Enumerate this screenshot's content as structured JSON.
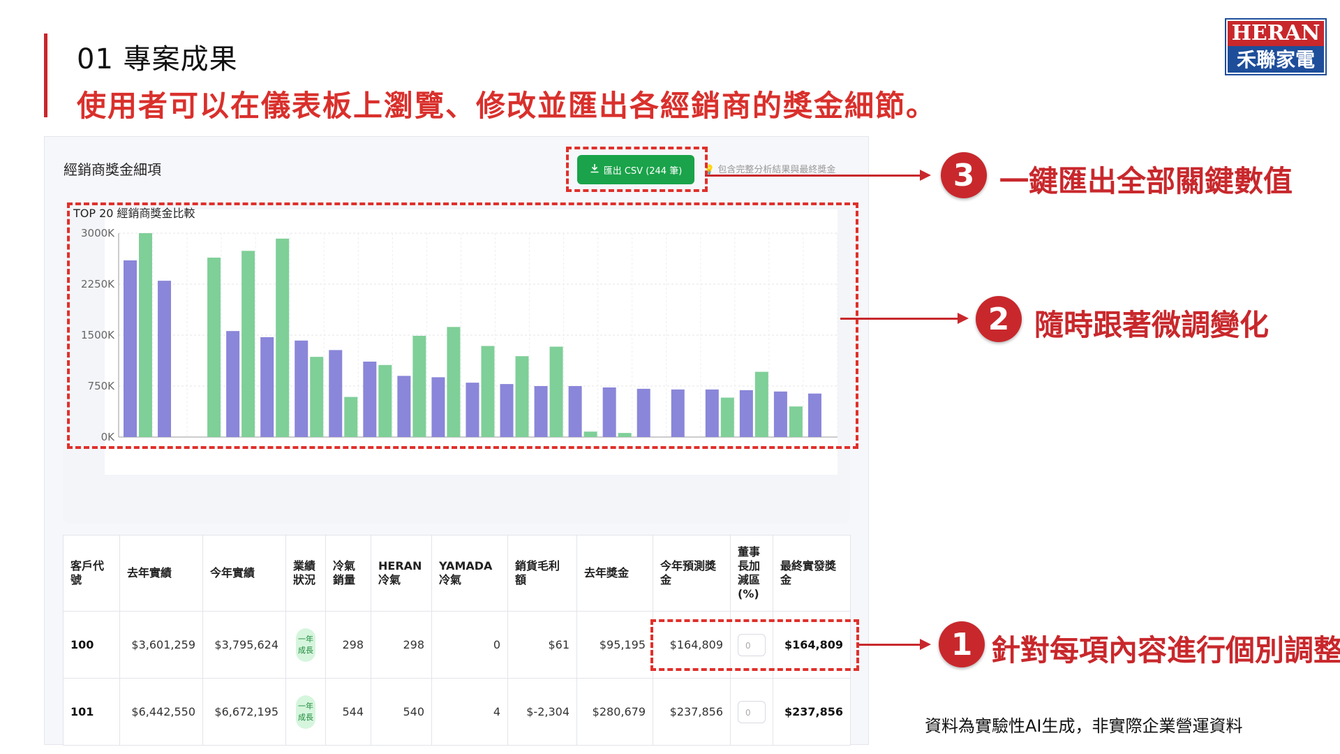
{
  "slide": {
    "title": "01 專案成果",
    "subtitle": "使用者可以在儀表板上瀏覽、修改並匯出各經銷商的獎金細節。",
    "logo_top": "HERAN",
    "logo_bottom": "禾聯家電",
    "footnote": "資料為實驗性AI生成，非實際企業營運資料"
  },
  "dashboard": {
    "card_title": "經銷商獎金細項",
    "export_button": "匯出 CSV (244 筆)",
    "export_note": "包含完整分析結果與最終獎金",
    "chart_title": "TOP 20 經銷商獎金比較"
  },
  "chart_data": {
    "type": "bar",
    "title": "TOP 20 經銷商獎金比較",
    "y_ticks": [
      "3000K",
      "2250K",
      "1500K",
      "750K",
      "0K"
    ],
    "ylim": [
      0,
      3000
    ],
    "series": [
      {
        "color": "#8a86d9",
        "values": [
          2600,
          2300,
          0,
          1560,
          1470,
          1420,
          1280,
          1110,
          900,
          880,
          800,
          780,
          750,
          750,
          730,
          710,
          700,
          700,
          690,
          670,
          640
        ]
      },
      {
        "color": "#7fcf98",
        "values": [
          3000,
          0,
          2640,
          2740,
          2920,
          1180,
          590,
          1060,
          1490,
          1620,
          1340,
          1190,
          1330,
          80,
          60,
          0,
          0,
          580,
          960,
          450,
          0
        ]
      }
    ]
  },
  "table": {
    "headers": [
      "客戶代號",
      "去年實績",
      "今年實績",
      "業績狀況",
      "冷氣銷量",
      "HERAN 冷氣",
      "YAMADA 冷氣",
      "銷貨毛利額",
      "去年獎金",
      "今年預測獎金",
      "董事長加減區(%)",
      "最終實發獎金"
    ],
    "rows": [
      {
        "id": "100",
        "last_year": "$3,601,259",
        "this_year": "$3,795,624",
        "status": "一年成長",
        "ac_sales": "298",
        "heran": "298",
        "yamada": "0",
        "margin": "$61",
        "last_bonus": "$95,195",
        "forecast": "$164,809",
        "adjust": "0",
        "final": "$164,809"
      },
      {
        "id": "101",
        "last_year": "$6,442,550",
        "this_year": "$6,672,195",
        "status": "一年成長",
        "ac_sales": "544",
        "heran": "540",
        "yamada": "4",
        "margin": "$-2,304",
        "last_bonus": "$280,679",
        "forecast": "$237,856",
        "adjust": "0",
        "final": "$237,856"
      }
    ]
  },
  "callouts": [
    {
      "num": "3",
      "text": "一鍵匯出全部關鍵數值"
    },
    {
      "num": "2",
      "text": "隨時跟著微調變化"
    },
    {
      "num": "1",
      "text": "針對每項內容進行個別調整"
    }
  ]
}
